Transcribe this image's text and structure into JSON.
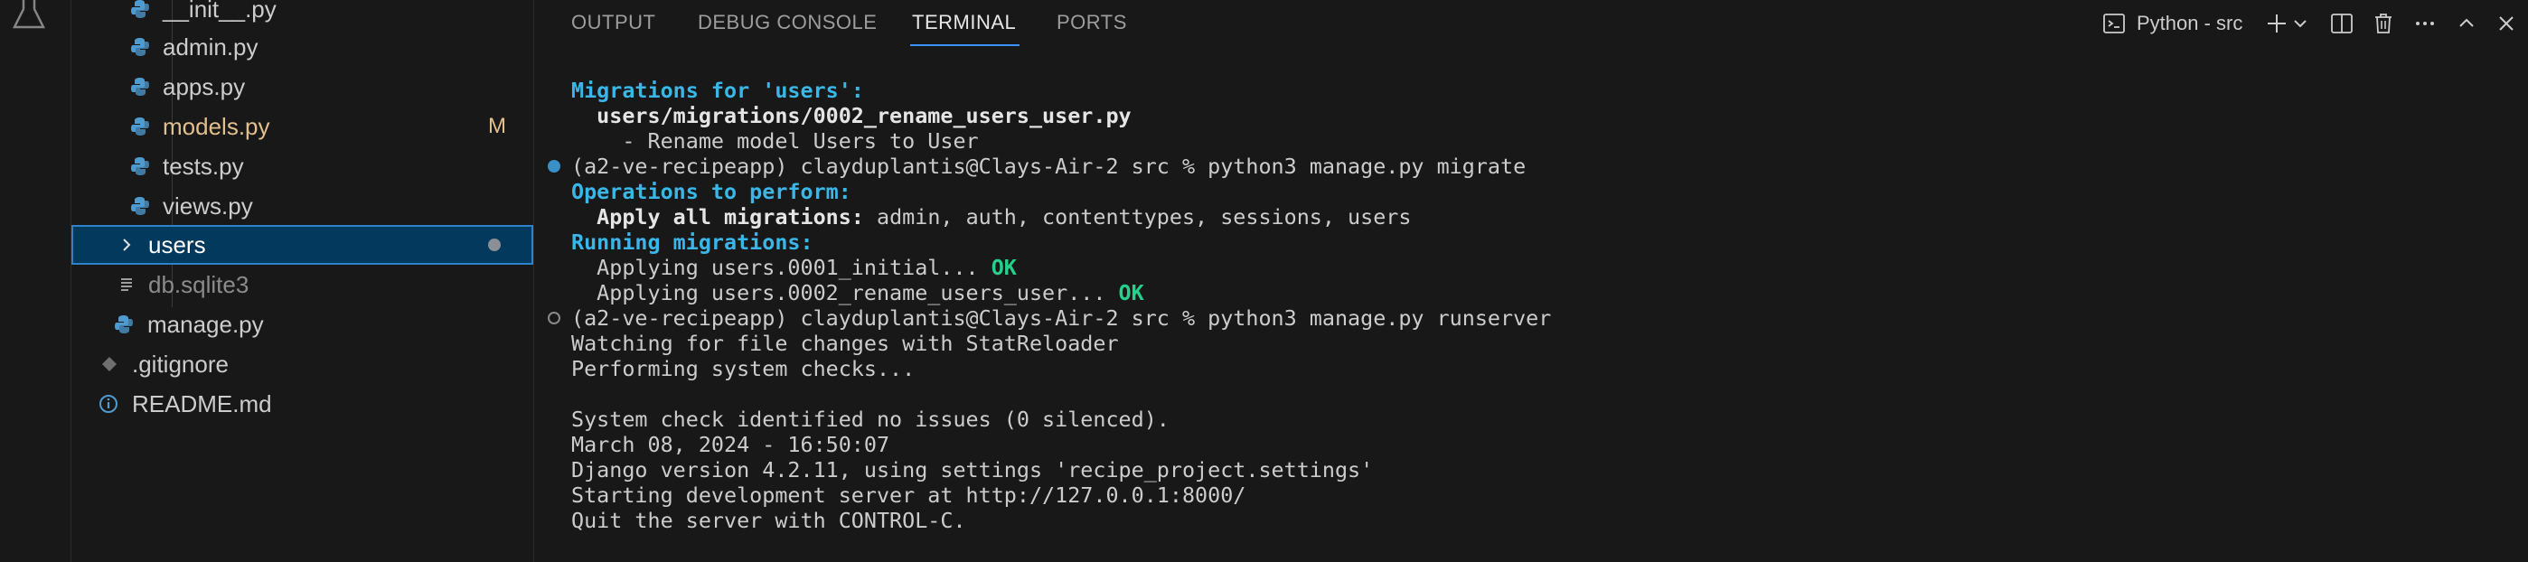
{
  "explorer": {
    "items": [
      {
        "label": "__init__.py",
        "icon": "python-icon"
      },
      {
        "label": "admin.py",
        "icon": "python-icon"
      },
      {
        "label": "apps.py",
        "icon": "python-icon"
      },
      {
        "label": "models.py",
        "icon": "python-icon",
        "badge": "M"
      },
      {
        "label": "tests.py",
        "icon": "python-icon"
      },
      {
        "label": "views.py",
        "icon": "python-icon"
      },
      {
        "label": "users",
        "icon": "chevron-right-icon"
      },
      {
        "label": "db.sqlite3",
        "icon": "lines-icon"
      },
      {
        "label": "manage.py",
        "icon": "python-icon"
      },
      {
        "label": ".gitignore",
        "icon": "diamond-icon"
      },
      {
        "label": "README.md",
        "icon": "info-icon"
      }
    ]
  },
  "panel": {
    "tabs": [
      "OUTPUT",
      "DEBUG CONSOLE",
      "TERMINAL",
      "PORTS"
    ],
    "active_tab": "TERMINAL",
    "terminal_name": "Python - src"
  },
  "terminal": {
    "lines": [
      {
        "parts": [
          {
            "t": "Migrations for 'users':",
            "s": "cyan"
          }
        ]
      },
      {
        "parts": [
          {
            "t": "  users/migrations/0002_rename_users_user.py",
            "s": "bold"
          }
        ]
      },
      {
        "parts": [
          {
            "t": "    - Rename model Users to User",
            "s": ""
          }
        ]
      },
      {
        "parts": [
          {
            "t": "(a2-ve-recipeapp) clayduplantis@Clays-Air-2 src % python3 manage.py migrate",
            "s": ""
          }
        ],
        "gutter": "filled"
      },
      {
        "parts": [
          {
            "t": "Operations to perform:",
            "s": "cyan"
          }
        ]
      },
      {
        "parts": [
          {
            "t": "  Apply all migrations:",
            "s": "bold"
          },
          {
            "t": " admin, auth, contenttypes, sessions, users",
            "s": ""
          }
        ]
      },
      {
        "parts": [
          {
            "t": "Running migrations:",
            "s": "cyan"
          }
        ]
      },
      {
        "parts": [
          {
            "t": "  Applying users.0001_initial... ",
            "s": ""
          },
          {
            "t": "OK",
            "s": "green"
          }
        ]
      },
      {
        "parts": [
          {
            "t": "  Applying users.0002_rename_users_user... ",
            "s": ""
          },
          {
            "t": "OK",
            "s": "green"
          }
        ]
      },
      {
        "parts": [
          {
            "t": "(a2-ve-recipeapp) clayduplantis@Clays-Air-2 src % python3 manage.py runserver",
            "s": ""
          }
        ],
        "gutter": "hollow"
      },
      {
        "parts": [
          {
            "t": "Watching for file changes with StatReloader",
            "s": ""
          }
        ]
      },
      {
        "parts": [
          {
            "t": "Performing system checks...",
            "s": ""
          }
        ]
      },
      {
        "parts": [
          {
            "t": "",
            "s": ""
          }
        ]
      },
      {
        "parts": [
          {
            "t": "System check identified no issues (0 silenced).",
            "s": ""
          }
        ]
      },
      {
        "parts": [
          {
            "t": "March 08, 2024 - 16:50:07",
            "s": ""
          }
        ]
      },
      {
        "parts": [
          {
            "t": "Django version 4.2.11, using settings 'recipe_project.settings'",
            "s": ""
          }
        ]
      },
      {
        "parts": [
          {
            "t": "Starting development server at http://127.0.0.1:8000/",
            "s": ""
          }
        ]
      },
      {
        "parts": [
          {
            "t": "Quit the server with CONTROL-C.",
            "s": ""
          }
        ]
      }
    ]
  },
  "colors": {
    "background": "#181818",
    "accent": "#3794ff",
    "selection": "#04395e",
    "modified": "#e2c08d",
    "terminal_cyan": "#3ab6e8",
    "terminal_green": "#23d18b"
  }
}
